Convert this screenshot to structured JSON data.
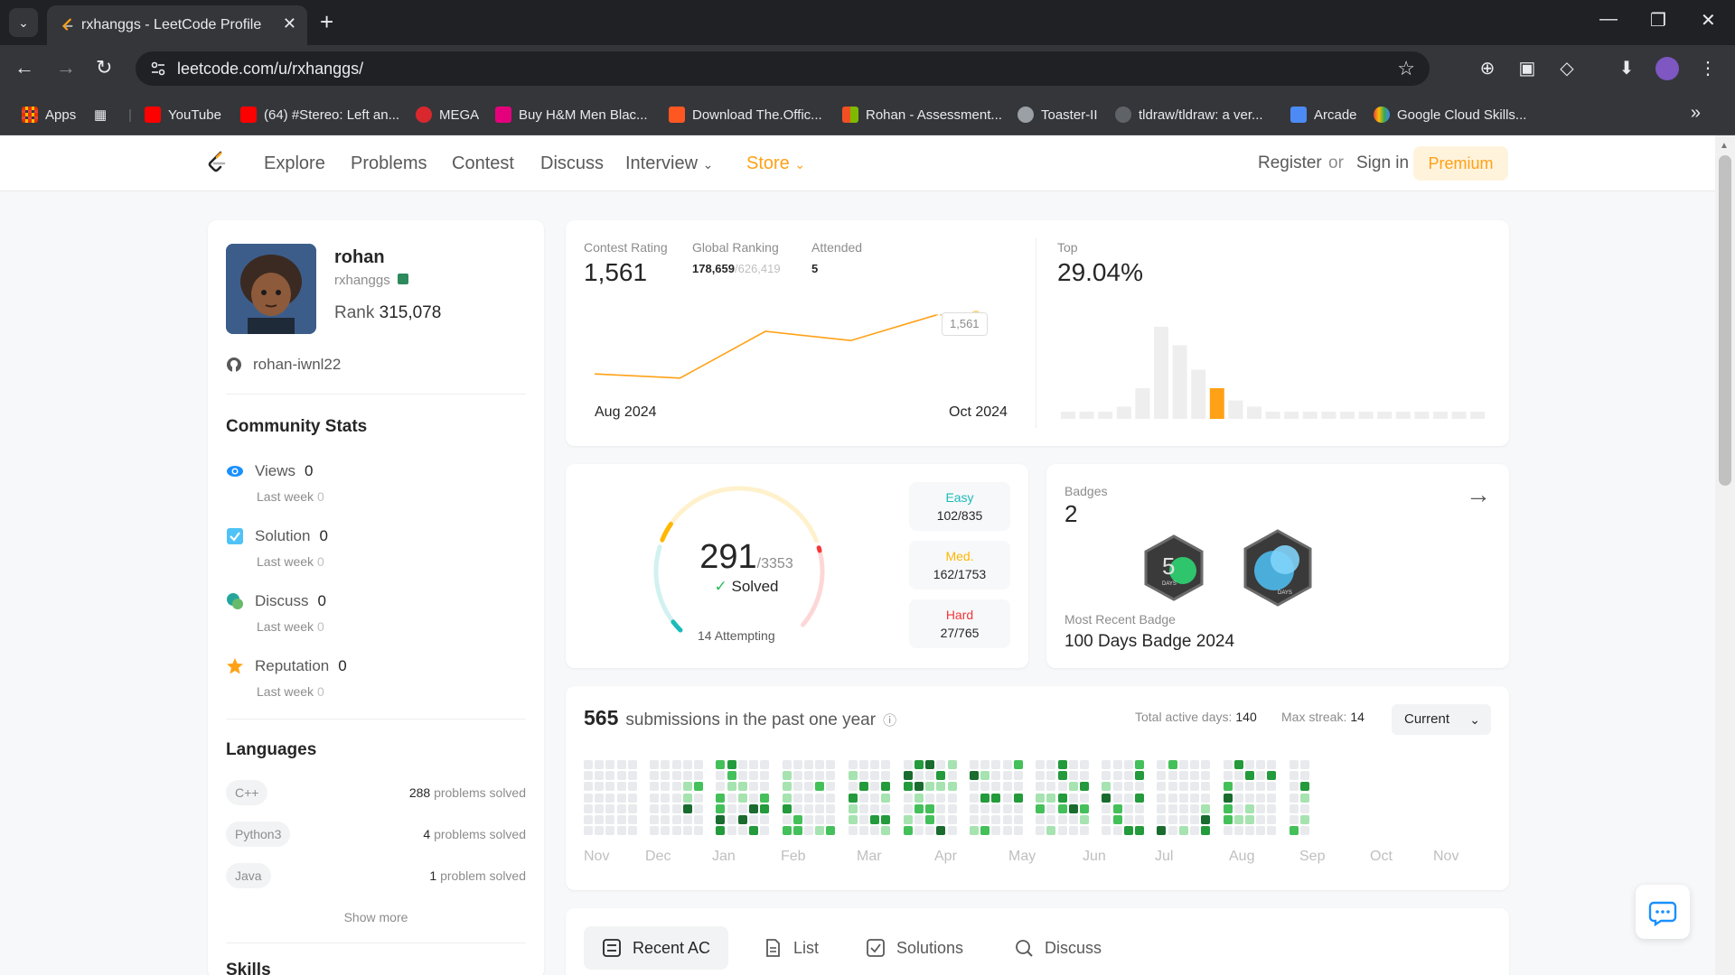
{
  "browser": {
    "tab_title": "rxhanggs - LeetCode Profile",
    "url": "leetcode.com/u/rxhanggs/",
    "bookmarks": [
      {
        "label": "Apps",
        "color": "#ea4335"
      },
      {
        "label": "YouTube",
        "color": "#ff0000"
      },
      {
        "label": "(64) #Stereo: Left an...",
        "color": "#ff0000"
      },
      {
        "label": "MEGA",
        "color": "#d9272e"
      },
      {
        "label": "Buy H&M Men Blac...",
        "color": "#e4007c"
      },
      {
        "label": "Download The.Offic...",
        "color": "#ff5722"
      },
      {
        "label": "Rohan - Assessment...",
        "color": "#00a4ef"
      },
      {
        "label": "Toaster-II",
        "color": "#9aa0a6"
      },
      {
        "label": "tldraw/tldraw: a ver...",
        "color": "#9aa0a6"
      },
      {
        "label": "Arcade",
        "color": "#4c8bf5"
      },
      {
        "label": "Google Cloud Skills...",
        "color": "#4285f4"
      }
    ]
  },
  "nav": {
    "items": [
      "Explore",
      "Problems",
      "Contest",
      "Discuss",
      "Interview",
      "Store"
    ],
    "register": "Register",
    "or": "or",
    "signin": "Sign in",
    "premium": "Premium"
  },
  "profile": {
    "name": "rohan",
    "username": "rxhanggs",
    "rank_label": "Rank",
    "rank": "315,078",
    "github": "rohan-iwnl22"
  },
  "community": {
    "title": "Community Stats",
    "last_week_label": "Last week",
    "stats": [
      {
        "label": "Views",
        "value": "0",
        "last_week": "0"
      },
      {
        "label": "Solution",
        "value": "0",
        "last_week": "0"
      },
      {
        "label": "Discuss",
        "value": "0",
        "last_week": "0"
      },
      {
        "label": "Reputation",
        "value": "0",
        "last_week": "0"
      }
    ]
  },
  "languages": {
    "title": "Languages",
    "items": [
      {
        "name": "C++",
        "count": "288",
        "suffix": "problems solved"
      },
      {
        "name": "Python3",
        "count": "4",
        "suffix": "problems solved"
      },
      {
        "name": "Java",
        "count": "1",
        "suffix": "problem solved"
      }
    ],
    "show_more": "Show more"
  },
  "skills": {
    "title": "Skills"
  },
  "contest": {
    "rating_label": "Contest Rating",
    "rating": "1,561",
    "global_label": "Global Ranking",
    "global_rank": "178,659",
    "global_total": "/626,419",
    "attended_label": "Attended",
    "attended": "5",
    "top_label": "Top",
    "top_value": "29.04%",
    "tooltip": "1,561",
    "x_start": "Aug 2024",
    "x_end": "Oct 2024"
  },
  "chart_data": [
    {
      "type": "line",
      "x": [
        "Aug 2024",
        "",
        "",
        "",
        "Oct 2024"
      ],
      "values": [
        1478,
        1472,
        1538,
        1525,
        1561
      ],
      "ylim": [
        1440,
        1580
      ]
    },
    {
      "type": "bar",
      "values": [
        1,
        1,
        1,
        2,
        5,
        15,
        12,
        8,
        5,
        3,
        2,
        1,
        1,
        1,
        1,
        1,
        1,
        1,
        1,
        1,
        1,
        1,
        1
      ],
      "highlight_index": 8,
      "highlight_color": "#ffa116",
      "bar_color": "#eeeeee"
    }
  ],
  "solved": {
    "count": "291",
    "total": "/3353",
    "solved_label": "Solved",
    "attempting": "14 Attempting",
    "easy_label": "Easy",
    "easy": "102/835",
    "easy_solved": 102,
    "easy_total": 835,
    "med_label": "Med.",
    "med": "162/1753",
    "med_solved": 162,
    "med_total": 1753,
    "hard_label": "Hard",
    "hard": "27/765",
    "hard_solved": 27,
    "hard_total": 765,
    "colors": {
      "easy": "#1cbaba",
      "med": "#ffb700",
      "hard": "#f63737"
    }
  },
  "badges": {
    "label": "Badges",
    "count": "2",
    "recent_label": "Most Recent Badge",
    "recent": "100 Days Badge 2024",
    "items": [
      {
        "name": "50 Days Badge",
        "text": "DAYS",
        "num": "5"
      },
      {
        "name": "100 Days Badge 2024",
        "text": "DAYS",
        "num": ""
      }
    ]
  },
  "submissions": {
    "count": "565",
    "label": "submissions in the past one year",
    "active_label": "Total active days:",
    "active": "140",
    "streak_label": "Max streak:",
    "streak": "14",
    "select": "Current",
    "months": [
      "Nov",
      "Dec",
      "Jan",
      "Feb",
      "Mar",
      "Apr",
      "May",
      "Jun",
      "Jul",
      "Aug",
      "Sep",
      "Oct",
      "Nov"
    ]
  },
  "tabs": {
    "items": [
      "Recent AC",
      "List",
      "Solutions",
      "Discuss"
    ]
  }
}
